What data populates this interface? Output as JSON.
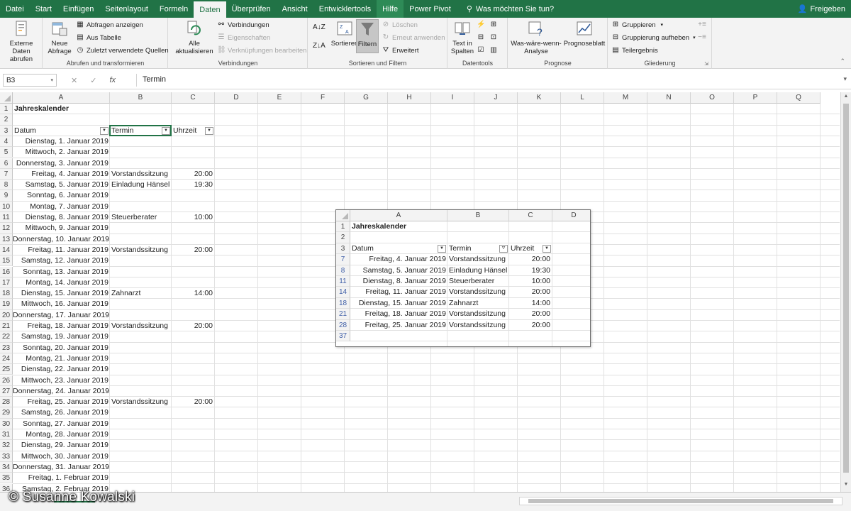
{
  "tabs": [
    "Datei",
    "Start",
    "Einfügen",
    "Seitenlayout",
    "Formeln",
    "Daten",
    "Überprüfen",
    "Ansicht",
    "Entwicklertools",
    "Hilfe",
    "Power Pivot"
  ],
  "active_tab": "Daten",
  "tell_me": "Was möchten Sie tun?",
  "share": "Freigeben",
  "ribbon": {
    "externe_daten": "Externe Daten abrufen",
    "neue_abfrage": "Neue Abfrage",
    "abfragen_anzeigen": "Abfragen anzeigen",
    "aus_tabelle": "Aus Tabelle",
    "zuletzt_quellen": "Zuletzt verwendete Quellen",
    "group_abrufen": "Abrufen und transformieren",
    "alle_aktualisieren": "Alle aktualisieren",
    "verbindungen": "Verbindungen",
    "eigenschaften": "Eigenschaften",
    "verknuepfungen": "Verknüpfungen bearbeiten",
    "group_verbindungen": "Verbindungen",
    "sortieren": "Sortieren",
    "filtern": "Filtern",
    "loeschen": "Löschen",
    "erneut": "Erneut anwenden",
    "erweitert": "Erweitert",
    "group_sortieren": "Sortieren und Filtern",
    "text_in_spalten": "Text in Spalten",
    "group_datentools": "Datentools",
    "was_waere": "Was-wäre-wenn-Analyse",
    "prognoseblatt": "Prognoseblatt",
    "group_prognose": "Prognose",
    "gruppieren": "Gruppieren",
    "gruppierung_aufheben": "Gruppierung aufheben",
    "teilergebnis": "Teilergebnis",
    "group_gliederung": "Gliederung"
  },
  "formula_bar": {
    "name_box": "B3",
    "formula": "Termin"
  },
  "columns": [
    "A",
    "B",
    "C",
    "D",
    "E",
    "F",
    "G",
    "H",
    "I",
    "J",
    "K",
    "L",
    "M",
    "N",
    "O",
    "P",
    "Q"
  ],
  "rows": [
    {
      "n": "1",
      "a": "Jahreskalender",
      "b": "",
      "c": ""
    },
    {
      "n": "2",
      "a": "",
      "b": "",
      "c": ""
    },
    {
      "n": "3",
      "a": "Datum",
      "b": "Termin",
      "c": "Uhrzeit"
    },
    {
      "n": "4",
      "a": "Dienstag, 1. Januar 2019",
      "b": "",
      "c": ""
    },
    {
      "n": "5",
      "a": "Mittwoch, 2. Januar 2019",
      "b": "",
      "c": ""
    },
    {
      "n": "6",
      "a": "Donnerstag, 3. Januar 2019",
      "b": "",
      "c": ""
    },
    {
      "n": "7",
      "a": "Freitag, 4. Januar 2019",
      "b": "Vorstandssitzung",
      "c": "20:00"
    },
    {
      "n": "8",
      "a": "Samstag, 5. Januar 2019",
      "b": "Einladung Hänsel",
      "c": "19:30"
    },
    {
      "n": "9",
      "a": "Sonntag, 6. Januar 2019",
      "b": "",
      "c": ""
    },
    {
      "n": "10",
      "a": "Montag, 7. Januar 2019",
      "b": "",
      "c": ""
    },
    {
      "n": "11",
      "a": "Dienstag, 8. Januar 2019",
      "b": "Steuerberater",
      "c": "10:00"
    },
    {
      "n": "12",
      "a": "Mittwoch, 9. Januar 2019",
      "b": "",
      "c": ""
    },
    {
      "n": "13",
      "a": "Donnerstag, 10. Januar 2019",
      "b": "",
      "c": ""
    },
    {
      "n": "14",
      "a": "Freitag, 11. Januar 2019",
      "b": "Vorstandssitzung",
      "c": "20:00"
    },
    {
      "n": "15",
      "a": "Samstag, 12. Januar 2019",
      "b": "",
      "c": ""
    },
    {
      "n": "16",
      "a": "Sonntag, 13. Januar 2019",
      "b": "",
      "c": ""
    },
    {
      "n": "17",
      "a": "Montag, 14. Januar 2019",
      "b": "",
      "c": ""
    },
    {
      "n": "18",
      "a": "Dienstag, 15. Januar 2019",
      "b": "Zahnarzt",
      "c": "14:00"
    },
    {
      "n": "19",
      "a": "Mittwoch, 16. Januar 2019",
      "b": "",
      "c": ""
    },
    {
      "n": "20",
      "a": "Donnerstag, 17. Januar 2019",
      "b": "",
      "c": ""
    },
    {
      "n": "21",
      "a": "Freitag, 18. Januar 2019",
      "b": "Vorstandssitzung",
      "c": "20:00"
    },
    {
      "n": "22",
      "a": "Samstag, 19. Januar 2019",
      "b": "",
      "c": ""
    },
    {
      "n": "23",
      "a": "Sonntag, 20. Januar 2019",
      "b": "",
      "c": ""
    },
    {
      "n": "24",
      "a": "Montag, 21. Januar 2019",
      "b": "",
      "c": ""
    },
    {
      "n": "25",
      "a": "Dienstag, 22. Januar 2019",
      "b": "",
      "c": ""
    },
    {
      "n": "26",
      "a": "Mittwoch, 23. Januar 2019",
      "b": "",
      "c": ""
    },
    {
      "n": "27",
      "a": "Donnerstag, 24. Januar 2019",
      "b": "",
      "c": ""
    },
    {
      "n": "28",
      "a": "Freitag, 25. Januar 2019",
      "b": "Vorstandssitzung",
      "c": "20:00"
    },
    {
      "n": "29",
      "a": "Samstag, 26. Januar 2019",
      "b": "",
      "c": ""
    },
    {
      "n": "30",
      "a": "Sonntag, 27. Januar 2019",
      "b": "",
      "c": ""
    },
    {
      "n": "31",
      "a": "Montag, 28. Januar 2019",
      "b": "",
      "c": ""
    },
    {
      "n": "32",
      "a": "Dienstag, 29. Januar 2019",
      "b": "",
      "c": ""
    },
    {
      "n": "33",
      "a": "Mittwoch, 30. Januar 2019",
      "b": "",
      "c": ""
    },
    {
      "n": "34",
      "a": "Donnerstag, 31. Januar 2019",
      "b": "",
      "c": ""
    },
    {
      "n": "35",
      "a": "Freitag, 1. Februar 2019",
      "b": "",
      "c": ""
    },
    {
      "n": "36",
      "a": "Samstag, 2. Februar 2019",
      "b": "",
      "c": ""
    }
  ],
  "inset": {
    "columns": [
      "A",
      "B",
      "C",
      "D"
    ],
    "rows": [
      {
        "n": "1",
        "a": "Jahreskalender",
        "b": "",
        "c": ""
      },
      {
        "n": "2",
        "a": "",
        "b": "",
        "c": ""
      },
      {
        "n": "3",
        "a": "Datum",
        "b": "Termin",
        "c": "Uhrzeit"
      },
      {
        "n": "7",
        "a": "Freitag, 4. Januar 2019",
        "b": "Vorstandssitzung",
        "c": "20:00"
      },
      {
        "n": "8",
        "a": "Samstag, 5. Januar 2019",
        "b": "Einladung Hänsel",
        "c": "19:30"
      },
      {
        "n": "11",
        "a": "Dienstag, 8. Januar 2019",
        "b": "Steuerberater",
        "c": "10:00"
      },
      {
        "n": "14",
        "a": "Freitag, 11. Januar 2019",
        "b": "Vorstandssitzung",
        "c": "20:00"
      },
      {
        "n": "18",
        "a": "Dienstag, 15. Januar 2019",
        "b": "Zahnarzt",
        "c": "14:00"
      },
      {
        "n": "21",
        "a": "Freitag, 18. Januar 2019",
        "b": "Vorstandssitzung",
        "c": "20:00"
      },
      {
        "n": "28",
        "a": "Freitag, 25. Januar 2019",
        "b": "Vorstandssitzung",
        "c": "20:00"
      },
      {
        "n": "37",
        "a": "",
        "b": "",
        "c": ""
      }
    ]
  },
  "watermark": "© Susanne Kowalski",
  "colors": {
    "excel_green": "#217346",
    "filtered_row_number": "#3f5fa7"
  }
}
